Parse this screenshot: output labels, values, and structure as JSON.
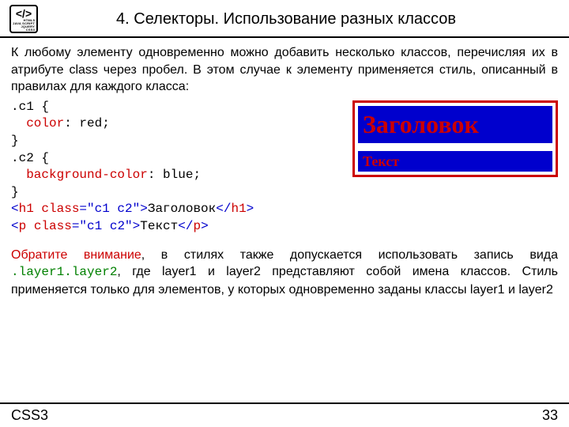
{
  "logo": {
    "lines": [
      "HTML5",
      "JAVA SCRIPT",
      "JQUERY",
      "CSS3"
    ]
  },
  "title": "4. Селекторы. Использование разных классов",
  "intro": "К любому элементу одновременно можно добавить несколько классов, перечисляя их в атрибуте class через пробел. В этом случае к элементу применяется стиль, описанный в правилах для каждого класса:",
  "code": {
    "l1": ".c1 {",
    "l2a": "color",
    "l2b": ": red;",
    "l3": "}",
    "l4": ".c2 {",
    "l5a": "background-color",
    "l5b": ": blue;",
    "l6": "}",
    "l7a": "<",
    "l7b": "h1 class",
    "l7c": "=\"c1 c2\">",
    "l7d": "Заголовок",
    "l7e": "</",
    "l7f": "h1",
    "l7g": ">",
    "l8a": "<",
    "l8b": "p class",
    "l8c": "=\"c1 c2\">",
    "l8d": "Текст",
    "l8e": "</",
    "l8f": "p",
    "l8g": ">"
  },
  "example": {
    "heading": "Заголовок",
    "text": "Текст"
  },
  "note": {
    "hl": "Обратите внимание",
    "p1": ", в стилях также допускается использовать запись вида ",
    "mono": ".layer1.layer2",
    "p2": ", где layer1 и layer2 представляют собой имена классов. Стиль применяется только для элементов, у которых одновременно заданы классы layer1 и layer2"
  },
  "footer": {
    "left": "CSS3",
    "right": "33"
  }
}
